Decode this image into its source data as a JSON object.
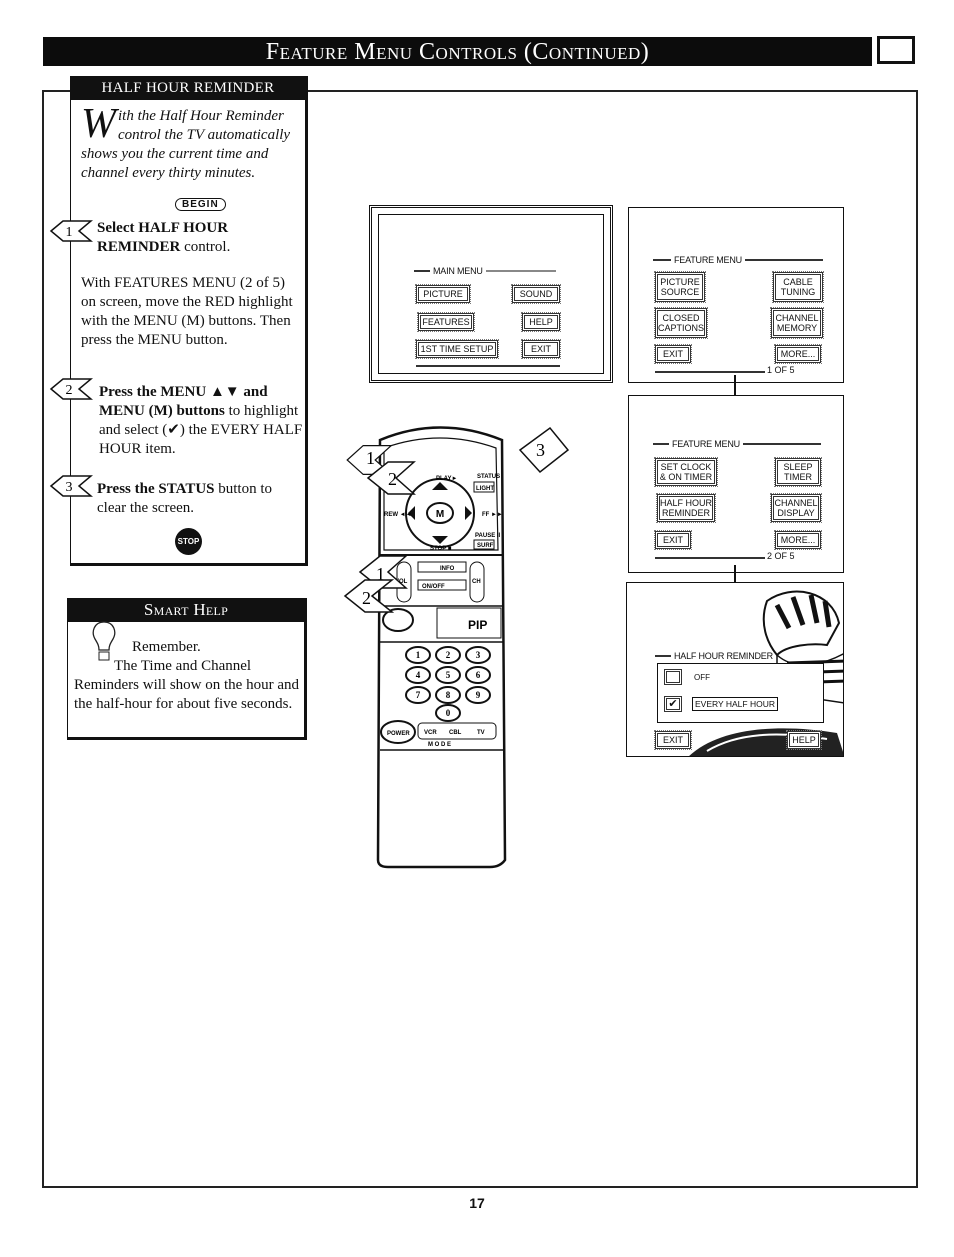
{
  "header": {
    "title": "Feature Menu Controls (Continued)"
  },
  "reminder_box": {
    "title": "HALF HOUR REMINDER",
    "intro_dropcap": "W",
    "intro": "ith the Half Hour Reminder control the TV automatically shows you the current time and channel every thirty minutes.",
    "begin": "BEGIN",
    "steps": [
      {
        "num": "1",
        "bold": "Select HALF HOUR REMINDER",
        "rest": " control.",
        "detail": "With FEATURES MENU (2 of 5) on screen, move the RED highlight with the MENU (M) buttons. Then press the MENU button."
      },
      {
        "num": "2",
        "bold": "Press the MENU ▲▼ and MENU (M) buttons",
        "rest": " to highlight and select (✔) the EVERY HALF HOUR item."
      },
      {
        "num": "3",
        "bold": "Press the STATUS",
        "rest": " button to clear the screen."
      }
    ],
    "stop": "STOP"
  },
  "smart_help": {
    "title": "Smart Help",
    "remember": "Remember.",
    "text": "The Time and Channel Reminders will show on the hour and the half-hour for about five seconds."
  },
  "screens": {
    "main_menu": {
      "title": "MAIN MENU",
      "buttons": [
        "PICTURE",
        "SOUND",
        "FEATURES",
        "HELP",
        "1ST TIME SETUP",
        "EXIT"
      ]
    },
    "feature_menu_1": {
      "title": "FEATURE MENU",
      "buttons": [
        "PICTURE SOURCE",
        "CABLE TUNING",
        "CLOSED CAPTIONS",
        "CHANNEL MEMORY",
        "EXIT",
        "MORE..."
      ],
      "page": "1 OF 5"
    },
    "feature_menu_2": {
      "title": "FEATURE MENU",
      "buttons": [
        "SET CLOCK & ON TIMER",
        "SLEEP TIMER",
        "HALF HOUR REMINDER",
        "CHANNEL DISPLAY",
        "EXIT",
        "MORE..."
      ],
      "page": "2 OF 5"
    },
    "half_hour": {
      "title": "HALF HOUR REMINDER",
      "options": [
        {
          "label": "OFF",
          "checked": false
        },
        {
          "label": "EVERY HALF HOUR",
          "checked": true
        }
      ],
      "buttons": [
        "EXIT",
        "HELP"
      ]
    }
  },
  "remote": {
    "labels": {
      "play": "PLAY►",
      "status": "STATUS",
      "light": "LIGHT",
      "rew": "REW ◄◄",
      "ff": "FF ►►",
      "menu": "M",
      "stop": "STOP ■",
      "pause": "PAUSE II",
      "surf": "SURF",
      "info": "INFO",
      "onoff": "ON/OFF",
      "vol": "VOL",
      "ch": "CH",
      "pip": "PIP",
      "power": "POWER",
      "mode": "M O D E",
      "vcr": "VCR",
      "cbl": "CBL",
      "tv": "TV"
    },
    "digits": [
      "1",
      "2",
      "3",
      "4",
      "5",
      "6",
      "7",
      "8",
      "9",
      "0"
    ],
    "callouts": [
      "1",
      "2",
      "3",
      "1",
      "2"
    ]
  },
  "page_number": "17"
}
